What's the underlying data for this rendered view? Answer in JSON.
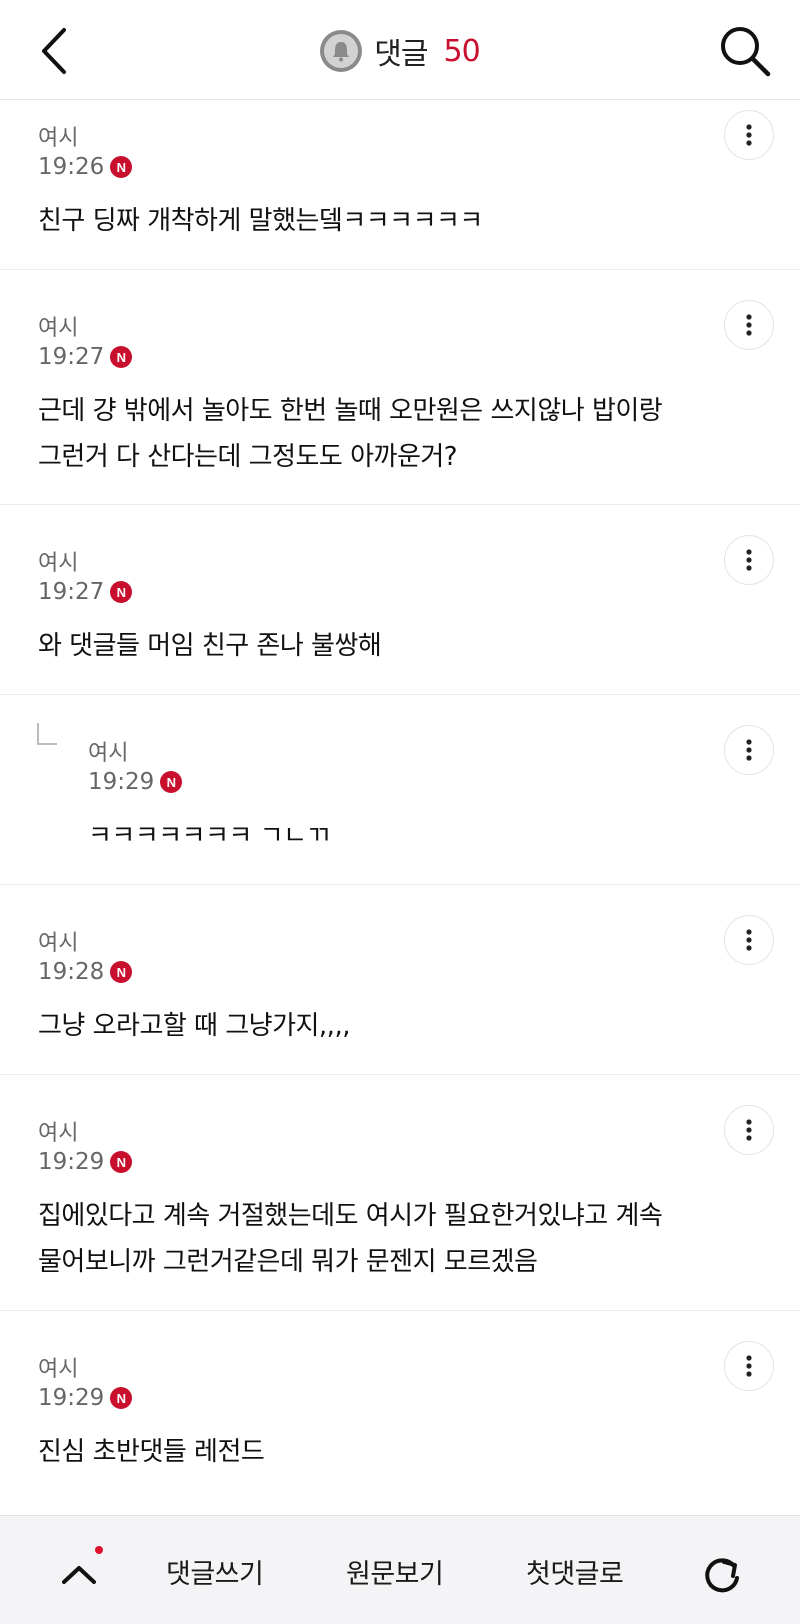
{
  "header": {
    "title": "댓글",
    "count": "50",
    "accent_color": "#c8102e",
    "icons": {
      "back": "back-arrow-icon",
      "bell": "bell-icon",
      "search": "search-icon"
    }
  },
  "comments": [
    {
      "author": "여시",
      "time": "19:26",
      "badge": "N",
      "lines": [
        "친구 딩짜 개착하게 말했는뎈ㅋㅋㅋㅋㅋㅋ"
      ],
      "reply": false
    },
    {
      "author": "여시",
      "time": "19:27",
      "badge": "N",
      "lines": [
        "근데 걍 밖에서 놀아도 한번 놀때 오만원은 쓰지않나 밥이랑",
        "그런거 다 산다는데 그정도도 아까운거?"
      ],
      "reply": false
    },
    {
      "author": "여시",
      "time": "19:27",
      "badge": "N",
      "lines": [
        "와 댓글들 머임 친구 존나 불쌍해"
      ],
      "reply": false
    },
    {
      "author": "여시",
      "time": "19:29",
      "badge": "N",
      "lines": [
        "ㅋㅋㅋㅋㅋㅋㅋ ㄱㄴㄲ"
      ],
      "reply": true
    },
    {
      "author": "여시",
      "time": "19:28",
      "badge": "N",
      "lines": [
        "그냥 오라고할 때 그냥가지,,,,"
      ],
      "reply": false
    },
    {
      "author": "여시",
      "time": "19:29",
      "badge": "N",
      "lines": [
        "집에있다고 계속 거절했는데도 여시가 필요한거있냐고 계속",
        "물어보니까 그런거같은데 뭐가 문젠지 모르겠음"
      ],
      "reply": false
    },
    {
      "author": "여시",
      "time": "19:29",
      "badge": "N",
      "lines": [
        "진심 초반댓들 레전드"
      ],
      "reply": false
    }
  ],
  "bottom_bar": {
    "write_label": "댓글쓰기",
    "original_label": "원문보기",
    "first_label": "첫댓글로",
    "icons": {
      "up": "chevron-up-icon",
      "refresh": "refresh-icon"
    },
    "notification_dot_color": "#e0102e"
  }
}
